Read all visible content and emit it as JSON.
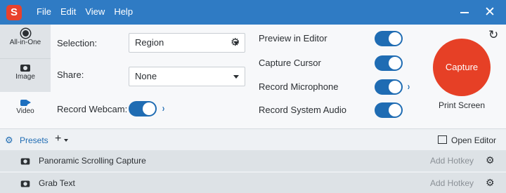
{
  "titlebar": {
    "app_icon_letter": "S",
    "menu": [
      "File",
      "Edit",
      "View",
      "Help"
    ],
    "minimize_icon": "minimize-icon",
    "close_icon": "close-icon",
    "close_glyph": "✕"
  },
  "modes": [
    {
      "label": "All-in-One",
      "icon": "record-circle-icon"
    },
    {
      "label": "Image",
      "icon": "camera-icon"
    },
    {
      "label": "Video",
      "icon": "video-camera-icon"
    }
  ],
  "settings": {
    "selection_label": "Selection:",
    "selection_value": "Region",
    "share_label": "Share:",
    "share_value": "None",
    "webcam_label": "Record Webcam:",
    "webcam_on": true
  },
  "toggles": [
    {
      "label": "Preview in Editor",
      "on": true,
      "has_more": false
    },
    {
      "label": "Capture Cursor",
      "on": true,
      "has_more": false
    },
    {
      "label": "Record Microphone",
      "on": true,
      "has_more": true
    },
    {
      "label": "Record System Audio",
      "on": true,
      "has_more": false
    }
  ],
  "capture": {
    "button_label": "Capture",
    "shortcut": "Print Screen",
    "reset_icon": "reset-icon",
    "reset_glyph": "↻"
  },
  "presets": {
    "label": "Presets",
    "add_glyph": "+",
    "open_editor_label": "Open Editor",
    "items": [
      {
        "name": "Panoramic Scrolling Capture",
        "hotkey": "Add Hotkey",
        "icon": "camera-icon"
      },
      {
        "name": "Grab Text",
        "hotkey": "Add Hotkey",
        "icon": "camera-icon"
      }
    ]
  },
  "glyphs": {
    "gear": "⚙",
    "chevron": "›"
  },
  "colors": {
    "titlebar": "#2f7bc4",
    "accent": "#1f6cb3",
    "capture": "#e64026",
    "app_icon": "#e8412c"
  }
}
